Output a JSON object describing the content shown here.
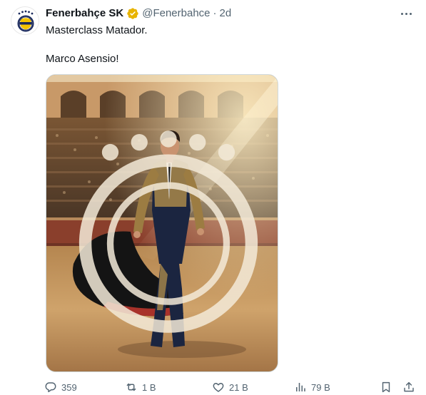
{
  "account": {
    "display_name": "Fenerbahçe SK",
    "handle": "@Fenerbahce",
    "separator": "·",
    "time": "2d",
    "verified_badge_color": "#e8b400",
    "avatar_icon": "fenerbahce-crest-icon"
  },
  "tweet": {
    "paragraphs": [
      "Masterclass Matador.",
      "Marco Asensio!"
    ],
    "image": {
      "alt_icon": "matador-photo",
      "watermark_icon": "fenerbahce-crest-watermark-icon"
    }
  },
  "actions": {
    "reply": {
      "icon": "reply-icon",
      "count": "359"
    },
    "retweet": {
      "icon": "retweet-icon",
      "count": "1 B"
    },
    "like": {
      "icon": "heart-icon",
      "count": "21 B"
    },
    "views": {
      "icon": "views-icon",
      "count": "79 B"
    },
    "bookmark": {
      "icon": "bookmark-icon"
    },
    "share": {
      "icon": "share-icon"
    }
  },
  "colors": {
    "text_primary": "#0f1419",
    "text_secondary": "#536471",
    "crest_navy": "#1b2a5c",
    "crest_yellow": "#f5c400"
  }
}
